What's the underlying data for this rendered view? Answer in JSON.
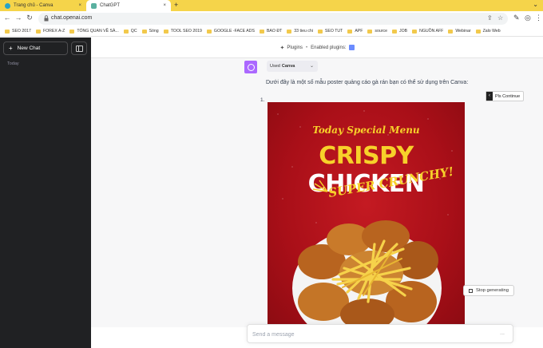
{
  "browser": {
    "tabs": [
      {
        "label": "Trang chủ - Canva",
        "close": "×"
      },
      {
        "label": "ChatGPT",
        "close": "×"
      }
    ],
    "new_tab": "+",
    "window_control": "⌄",
    "url": "chat.openai.com",
    "nav": {
      "back": "←",
      "forward": "→",
      "reload": "↻"
    },
    "bookmarks": [
      "SEO 2017",
      "FOREX A-Z",
      "TỔNG QUAN VỀ SÀ...",
      "QC",
      "Sóng",
      "TOOL SEO 2019",
      "GOOGLE -FACE ADS",
      "BAO ĐT",
      "33 tieu chi",
      "SEO TUT",
      "APF",
      "source",
      "JOB",
      "NGUỒN AFF",
      "Webinar",
      "Zalo Web"
    ]
  },
  "sidebar": {
    "new_chat_label": "New Chat",
    "new_chat_icon": "+",
    "section_today": "Today"
  },
  "header": {
    "plugins_label": "Plugins",
    "separator": "•",
    "enabled_label": "Enabled plugins:"
  },
  "message": {
    "used_prefix": "Used",
    "used_plugin": "Canva",
    "intro": "Dưới đây là một số mẫu poster quảng cáo gà rán bạn có thể sử dụng trên Canva:",
    "list_number": "1."
  },
  "poster": {
    "subtitle": "Today Special Menu",
    "title_word1": "CRISPY",
    "title_word2": "CHICKEN",
    "tagline": "SUPER CRUNCHY!"
  },
  "continue_button": {
    "arrow": "‹",
    "label": "Pls Continue"
  },
  "stop_button": {
    "label": "Stop generating"
  },
  "composer": {
    "placeholder": "Send a message",
    "more": "..."
  },
  "colors": {
    "sidebar_bg": "#202123",
    "accent_purple": "#ab68ff",
    "poster_red": "#b0121a",
    "poster_yellow": "#f7d12a",
    "tab_strip": "#f5d44a"
  }
}
